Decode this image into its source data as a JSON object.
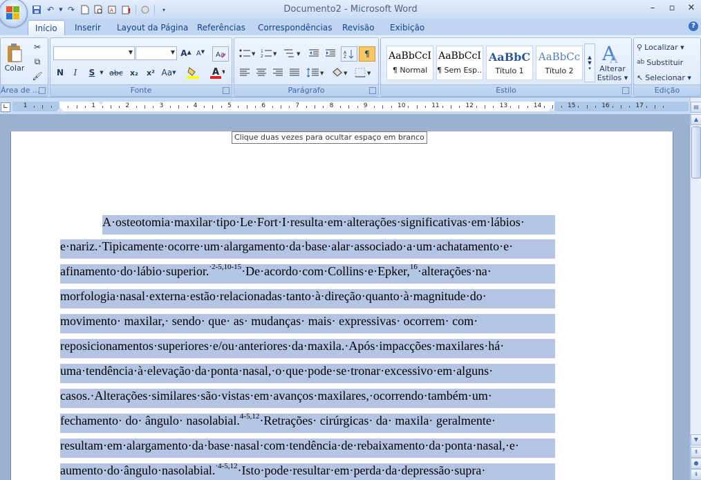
{
  "window": {
    "title": "Documento2 - Microsoft Word",
    "controls": [
      "minimize-icon",
      "restore-icon",
      "close-icon"
    ]
  },
  "quick_access": [
    "save-icon",
    "undo-icon",
    "redo-icon",
    "new-icon",
    "print-preview-icon",
    "format-painter-icon",
    "spelling-icon",
    "circle-icon",
    "customize-icon"
  ],
  "tabs": [
    {
      "label": "Início",
      "active": true
    },
    {
      "label": "Inserir"
    },
    {
      "label": "Layout da Página"
    },
    {
      "label": "Referências"
    },
    {
      "label": "Correspondências"
    },
    {
      "label": "Revisão"
    },
    {
      "label": "Exibição"
    }
  ],
  "ribbon": {
    "clipboard": {
      "label": "Área de ...",
      "paste": "Colar"
    },
    "font": {
      "label": "Fonte",
      "font_name": "",
      "font_size": "",
      "bold": "N",
      "italic": "I",
      "underline": "S",
      "strike": "abc",
      "subscript": "x₂",
      "superscript": "x²",
      "case": "Aa"
    },
    "paragraph": {
      "label": "Parágrafo"
    },
    "styles": {
      "label": "Estilo",
      "items": [
        {
          "sample": "AaBbCcI",
          "name": "¶ Normal"
        },
        {
          "sample": "AaBbCcI",
          "name": "¶ Sem Esp..."
        },
        {
          "sample": "AaBbC",
          "name": "Título 1"
        },
        {
          "sample": "AaBbCc",
          "name": "Título 2"
        }
      ],
      "change": "Alterar",
      "change2": "Estilos"
    },
    "editing": {
      "label": "Edição",
      "find": "Localizar",
      "replace": "Substituir",
      "select": "Selecionar"
    }
  },
  "ruler": {
    "numbers": [
      "1",
      "1",
      "2",
      "3",
      "4",
      "5",
      "6",
      "7",
      "8",
      "9",
      "10",
      "11",
      "12",
      "13",
      "14",
      "15",
      "16",
      "17"
    ]
  },
  "tooltip": "Clique duas vezes para ocultar espaço em branco",
  "document": {
    "lines": [
      "A·osteotomia·maxilar·tipo·Le·Fort·I·resulta·em·alterações·significativas·em·lábios·",
      "e·nariz.·Tipicamente·ocorre·um·alargamento·da·base·alar·associado·a·um·achatamento·e·",
      "afinamento·do·lábio·superior.",
      "morfologia·nasal·externa·estão·relacionadas·tanto·à·direção·quanto·à·magnitude·do·",
      "movimento· maxilar,· sendo· que· as· mudanças· mais· expressivas· ocorrem· com·",
      "reposicionamentos·superiores·e/ou·anteriores·da·maxila.·Após·impacções·maxilares·há·",
      "uma·tendência·à·elevação·da·ponta·nasal,·o·que·pode·se·tronar·excessivo·em·alguns·",
      "casos.·Alterações·similares·são·vistas·em·avanços·maxilares,·ocorrendo·também·um·",
      "fechamento· do· ângulo· nasolabial.",
      "resultam·em·alargamento·da·base·nasal·com·tendência·de·rebaixamento·da·ponta·nasal,·e·",
      "aumento·do·ângulo·nasolabial."
    ],
    "line3_sup1": "·2-5,10-15",
    "line3_mid": "·De·acordo·com·Collins·e·Epker,",
    "line3_sup2": "16",
    "line3_end": "·alterações·na·",
    "line9_sup": "4-5,12",
    "line9_end": "·Retrações· cirúrgicas· da· maxila· geralmente·",
    "line11_sup": "·4-5,12",
    "line11_end": "·Isto·pode·resultar·em·perda·da·depressão·supra·"
  },
  "colors": {
    "selection": "#b4c5e3",
    "ribbon": "#d5e3f6",
    "accent": "#15428b"
  }
}
